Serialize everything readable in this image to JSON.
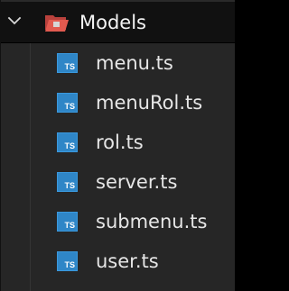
{
  "explorer": {
    "folder": {
      "name": "Models",
      "expanded": true,
      "chevron_icon": "chevron-down-icon",
      "folder_icon": "folder-open-icon",
      "folder_icon_color": "#e25a4f"
    },
    "files": [
      {
        "name": "menu.ts",
        "icon": "typescript-file-icon",
        "icon_text": "TS"
      },
      {
        "name": "menuRol.ts",
        "icon": "typescript-file-icon",
        "icon_text": "TS"
      },
      {
        "name": "rol.ts",
        "icon": "typescript-file-icon",
        "icon_text": "TS"
      },
      {
        "name": "server.ts",
        "icon": "typescript-file-icon",
        "icon_text": "TS"
      },
      {
        "name": "submenu.ts",
        "icon": "typescript-file-icon",
        "icon_text": "TS"
      },
      {
        "name": "user.ts",
        "icon": "typescript-file-icon",
        "icon_text": "TS"
      }
    ],
    "colors": {
      "background": "#262626",
      "folder_row_background": "#111111",
      "text": "#e6e6e6",
      "typescript_icon": "#2f86c7"
    }
  }
}
